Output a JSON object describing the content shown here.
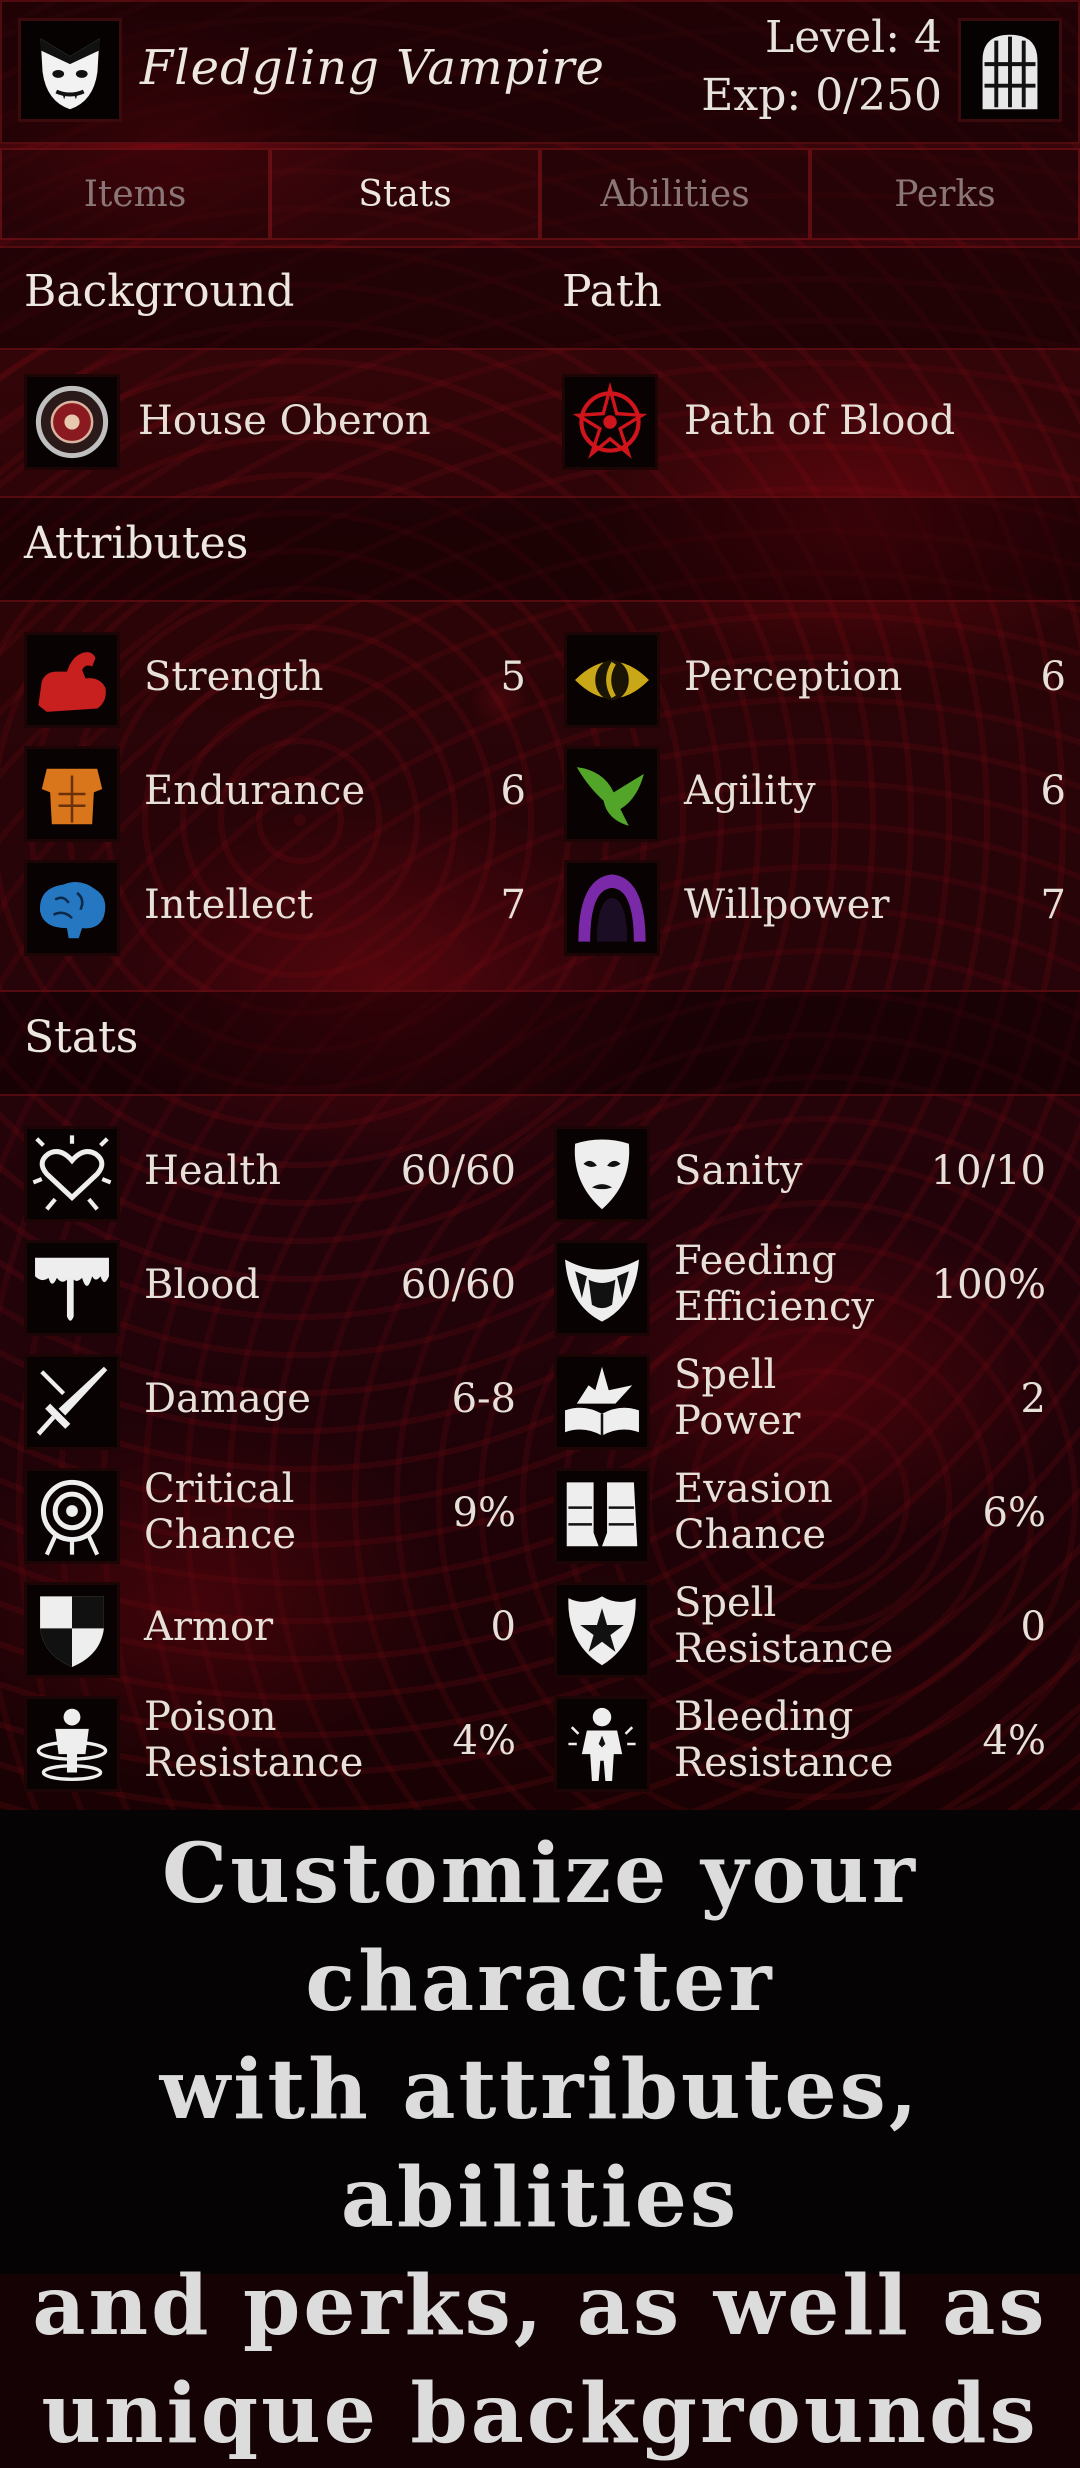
{
  "header": {
    "title": "Fledgling Vampire",
    "level": "Level: 4",
    "exp": "Exp: 0/250",
    "avatar_icon": "vampire-face-icon",
    "menu_icon": "door-icon"
  },
  "tabs": [
    {
      "label": "Items"
    },
    {
      "label": "Stats"
    },
    {
      "label": "Abilities"
    },
    {
      "label": "Perks"
    }
  ],
  "background": {
    "heading": "Background",
    "value": "House Oberon",
    "icon": "crest-icon"
  },
  "path": {
    "heading": "Path",
    "value": "Path of Blood",
    "icon": "blood-sigil-icon"
  },
  "attributes": {
    "heading": "Attributes",
    "items": [
      {
        "label": "Strength",
        "value": "5",
        "icon": "arm-icon",
        "color": "#c8201e"
      },
      {
        "label": "Perception",
        "value": "6",
        "icon": "eye-icon",
        "color": "#c9a716"
      },
      {
        "label": "Endurance",
        "value": "6",
        "icon": "torso-icon",
        "color": "#d9751b"
      },
      {
        "label": "Agility",
        "value": "6",
        "icon": "wing-icon",
        "color": "#53a52a"
      },
      {
        "label": "Intellect",
        "value": "7",
        "icon": "brain-icon",
        "color": "#2577c2"
      },
      {
        "label": "Willpower",
        "value": "7",
        "icon": "hooded-figure-icon",
        "color": "#7a2aa8"
      }
    ]
  },
  "stats": {
    "heading": "Stats",
    "items": [
      {
        "label": [
          "Health"
        ],
        "value": "60/60",
        "icon": "heart-icon"
      },
      {
        "label": [
          "Sanity"
        ],
        "value": "10/10",
        "icon": "mask-icon"
      },
      {
        "label": [
          "Blood"
        ],
        "value": "60/60",
        "icon": "blood-drip-icon"
      },
      {
        "label": [
          "Feeding",
          "Efficiency"
        ],
        "value": "100%",
        "icon": "fangs-icon"
      },
      {
        "label": [
          "Damage"
        ],
        "value": "6-8",
        "icon": "sword-icon"
      },
      {
        "label": [
          "Spell",
          "Power"
        ],
        "value": "2",
        "icon": "spellbook-icon"
      },
      {
        "label": [
          "Critical",
          "Chance"
        ],
        "value": "9%",
        "icon": "target-icon"
      },
      {
        "label": [
          "Evasion",
          "Chance"
        ],
        "value": "6%",
        "icon": "boots-icon"
      },
      {
        "label": [
          "Armor"
        ],
        "value": "0",
        "icon": "shield-icon"
      },
      {
        "label": [
          "Spell",
          "Resistance"
        ],
        "value": "0",
        "icon": "pentagram-shield-icon"
      },
      {
        "label": [
          "Poison",
          "Resistance"
        ],
        "value": "4%",
        "icon": "poison-icon"
      },
      {
        "label": [
          "Bleeding",
          "Resistance"
        ],
        "value": "4%",
        "icon": "bleeding-figure-icon"
      }
    ]
  },
  "caption": {
    "lines": [
      "Customize your character",
      "with attributes, abilities",
      "and perks, as well as",
      "unique backgrounds"
    ]
  }
}
